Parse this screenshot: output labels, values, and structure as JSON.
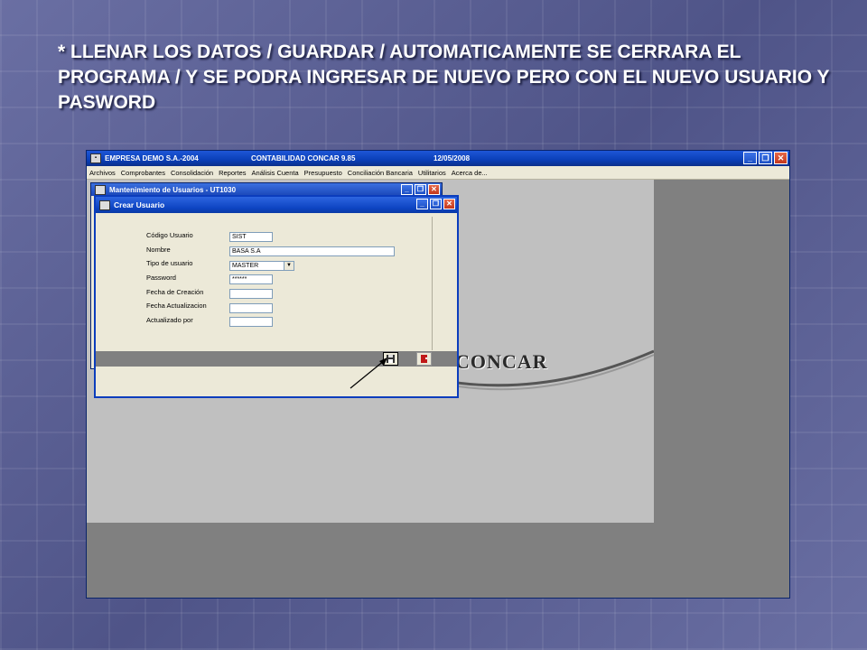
{
  "slide": {
    "title": "* LLENAR LOS DATOS / GUARDAR / AUTOMATICAMENTE SE CERRARA EL PROGRAMA / Y SE PODRA INGRESAR DE NUEVO PERO CON EL NUEVO USUARIO Y PASWORD"
  },
  "app": {
    "company": "EMPRESA DEMO S.A.-2004",
    "product": "CONTABILIDAD CONCAR 9.85",
    "date": "12/05/2008",
    "menu": [
      "Archivos",
      "Comprobantes",
      "Consolidación",
      "Reportes",
      "Análisis Cuenta",
      "Presupuesto",
      "Conciliación Bancaria",
      "Utilitarios",
      "Acerca de..."
    ],
    "logo_text": "CONCAR"
  },
  "back_window": {
    "title": "Mantenimiento de Usuarios - UT1030"
  },
  "dialog": {
    "title": "Crear Usuario",
    "fields": {
      "codigo_label": "Código Usuario",
      "codigo_value": "SIST",
      "nombre_label": "Nombre",
      "nombre_value": "BASA S.A",
      "tipo_label": "Tipo de usuario",
      "tipo_value": "MASTER",
      "password_label": "Password",
      "password_value": "******",
      "creacion_label": "Fecha de Creación",
      "creacion_value": "",
      "actualizacion_label": "Fecha Actualizacion",
      "actualizacion_value": "",
      "actualizado_label": "Actualizado por",
      "actualizado_value": ""
    }
  },
  "colors": {
    "titlebar": "#0a3fb8",
    "workspace": "#c0c0c0",
    "background": "#5a5f93"
  }
}
